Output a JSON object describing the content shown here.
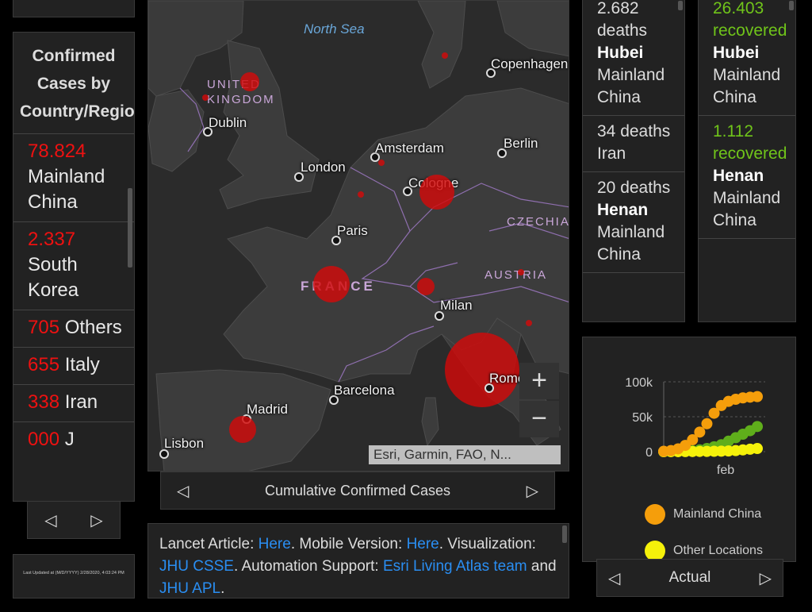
{
  "left": {
    "title": "Confirmed Cases by Country/Region",
    "items": [
      {
        "count": "78.824",
        "label": "Mainland China"
      },
      {
        "count": "2.337",
        "label": "South Korea"
      },
      {
        "count": "705",
        "label": "Others"
      },
      {
        "count": "655",
        "label": "Italy"
      },
      {
        "count": "338",
        "label": "Iran"
      },
      {
        "count": "000",
        "label": "J"
      }
    ],
    "last_updated": "Last Updated at (M/D/YYYY) 2/28/2020, 4:03:24 PM"
  },
  "map": {
    "sea": "North Sea",
    "cities": [
      "Dublin",
      "London",
      "Amsterdam",
      "Cologne",
      "Berlin",
      "Copenhagen",
      "Paris",
      "Milan",
      "Barcelona",
      "Madrid",
      "Lisbon",
      "Rome"
    ],
    "countries": [
      "UNITED KINGDOM",
      "FRANCE",
      "CZECHIA",
      "AUSTRIA"
    ],
    "zoom_in": "+",
    "zoom_out": "−",
    "attribution": "Esri, Garmin, FAO, N...",
    "nav_title": "Cumulative Confirmed Cases"
  },
  "info": {
    "p1": "Lancet Article: ",
    "l1": "Here",
    "p2": ". Mobile Version: ",
    "l2": "Here",
    "p3": ". Visualization: ",
    "l3": "JHU CSSE",
    "p4": ". Automation Support: ",
    "l4": "Esri Living Atlas team",
    "p5": " and ",
    "l5": "JHU APL",
    "p6": "."
  },
  "deaths": [
    {
      "count": "2.682",
      "unit": "deaths",
      "place": "Hubei",
      "region": "Mainland China"
    },
    {
      "count": "34",
      "unit": "deaths",
      "place": "",
      "region": "Iran"
    },
    {
      "count": "20",
      "unit": "deaths",
      "place": "Henan",
      "region": "Mainland China"
    }
  ],
  "recovered": [
    {
      "count": "26.403",
      "unit": "recovered",
      "place": "Hubei",
      "region": "Mainland China"
    },
    {
      "count": "1.112",
      "unit": "recovered",
      "place": "Henan",
      "region": "Mainland China"
    }
  ],
  "colors": {
    "red": "#e11111",
    "green": "#70c41a",
    "orange": "#f59e0b",
    "yellow": "#f5f10a",
    "link": "#2a8ef2"
  },
  "chart_data": {
    "type": "line",
    "y_ticks": [
      "100k",
      "50k",
      "0"
    ],
    "x_tick": "feb",
    "ylim": [
      0,
      100000
    ],
    "series": [
      {
        "name": "Mainland China",
        "color": "#f59e0b",
        "values": [
          500,
          1500,
          4000,
          9000,
          17000,
          28000,
          40000,
          55000,
          66000,
          72000,
          75000,
          77000,
          78000,
          78824
        ]
      },
      {
        "name": "Other Locations",
        "color": "#f5f10a",
        "values": [
          10,
          20,
          50,
          100,
          200,
          300,
          400,
          500,
          700,
          1000,
          1500,
          2500,
          3500,
          4500
        ]
      },
      {
        "name": "",
        "color": "#5fae1b",
        "values": [
          0,
          50,
          200,
          500,
          1200,
          2500,
          4500,
          7000,
          10000,
          15000,
          20000,
          25000,
          30000,
          36000
        ]
      }
    ],
    "nav_title": "Actual"
  }
}
